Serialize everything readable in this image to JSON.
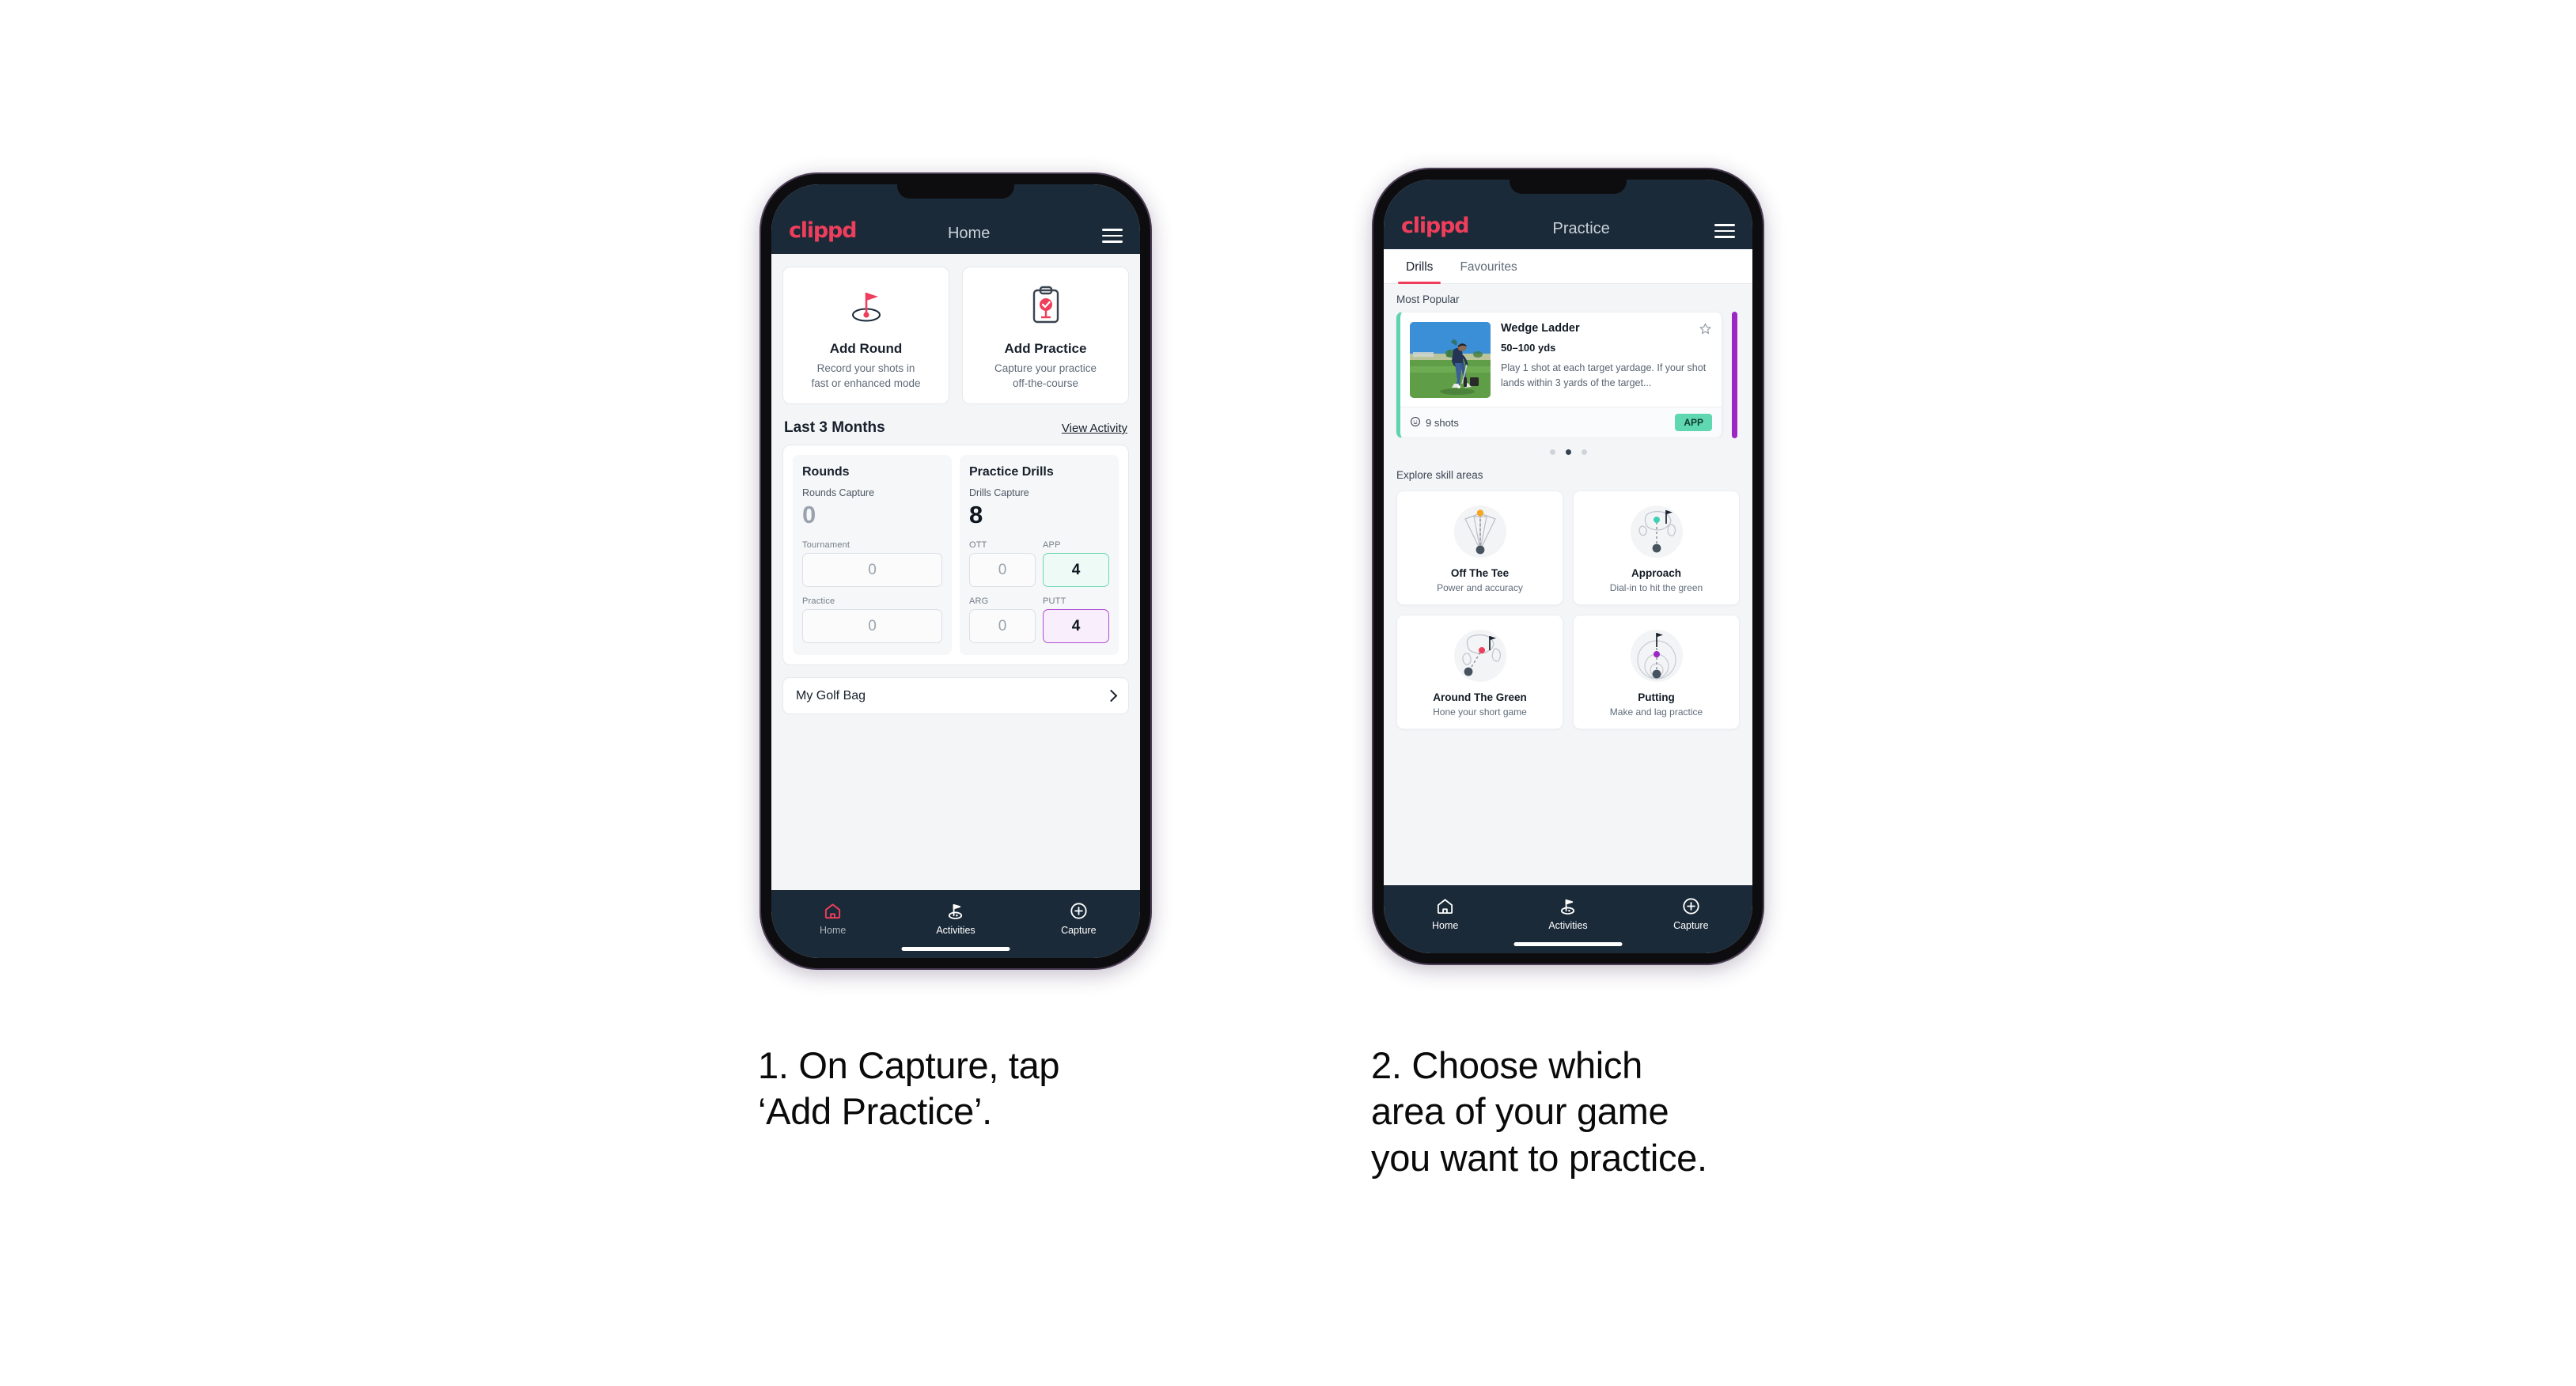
{
  "phone1": {
    "appbar": {
      "logo": "clippd",
      "title": "Home",
      "menu_icon": "hamburger-icon"
    },
    "actions": [
      {
        "icon": "golf-flag-icon",
        "title": "Add Round",
        "sub_line1": "Record your shots in",
        "sub_line2": "fast or enhanced mode"
      },
      {
        "icon": "clipboard-check-icon",
        "title": "Add Practice",
        "sub_line1": "Capture your practice",
        "sub_line2": "off-the-course"
      }
    ],
    "section": {
      "title": "Last 3 Months",
      "link": "View Activity"
    },
    "stats": {
      "rounds": {
        "name": "Rounds",
        "capture_label": "Rounds Capture",
        "capture_value": "0",
        "metrics": [
          {
            "label": "Tournament",
            "value": "0",
            "style": "plain"
          },
          {
            "label": "Practice",
            "value": "0",
            "style": "plain"
          }
        ]
      },
      "drills": {
        "name": "Practice Drills",
        "capture_label": "Drills Capture",
        "capture_value": "8",
        "metrics": [
          {
            "label": "OTT",
            "value": "0",
            "style": "plain"
          },
          {
            "label": "APP",
            "value": "4",
            "style": "green"
          },
          {
            "label": "ARG",
            "value": "0",
            "style": "plain"
          },
          {
            "label": "PUTT",
            "value": "4",
            "style": "purple"
          }
        ]
      }
    },
    "golf_bag": {
      "label": "My Golf Bag",
      "icon": "chevron-right-icon"
    },
    "nav": [
      {
        "icon": "home-icon",
        "label": "Home",
        "active": true
      },
      {
        "icon": "golf-activities-icon",
        "label": "Activities",
        "active": false
      },
      {
        "icon": "plus-circle-icon",
        "label": "Capture",
        "active": false
      }
    ]
  },
  "phone2": {
    "appbar": {
      "logo": "clippd",
      "title": "Practice",
      "menu_icon": "hamburger-icon"
    },
    "tabs": [
      {
        "label": "Drills",
        "active": true
      },
      {
        "label": "Favourites",
        "active": false
      }
    ],
    "most_popular_label": "Most Popular",
    "drill": {
      "title": "Wedge Ladder",
      "yardage": "50–100 yds",
      "description": "Play 1 shot at each target yardage. If your shot lands within 3 yards of the target...",
      "shots": "9 shots",
      "shots_icon": "clock-icon",
      "badge": "APP",
      "favourite_icon": "star-outline-icon",
      "accent_color": "#5ed3ad",
      "thumb_icon": "golfer-photo"
    },
    "carousel": {
      "dots": 3,
      "active_dot": 2,
      "next_card_accent": "#9b27c4"
    },
    "explore_label": "Explore skill areas",
    "skills": [
      {
        "name": "Off The Tee",
        "sub": "Power and accuracy",
        "icon": "tee-dispersion-icon",
        "dot_color": "#f5a623"
      },
      {
        "name": "Approach",
        "sub": "Dial-in to hit the green",
        "icon": "approach-green-icon",
        "dot_color": "#3fd0b5"
      },
      {
        "name": "Around The Green",
        "sub": "Hone your short game",
        "icon": "chip-green-icon",
        "dot_color": "#ef3e5c"
      },
      {
        "name": "Putting",
        "sub": "Make and lag practice",
        "icon": "putting-rings-icon",
        "dot_color": "#9b27c4"
      }
    ],
    "nav": [
      {
        "icon": "home-icon",
        "label": "Home",
        "active": false
      },
      {
        "icon": "golf-activities-icon",
        "label": "Activities",
        "active": false
      },
      {
        "icon": "plus-circle-icon",
        "label": "Capture",
        "active": false
      }
    ]
  },
  "captions": {
    "one_line1": "1. On Capture, tap",
    "one_line2": "‘Add Practice’.",
    "two_line1": "2. Choose which",
    "two_line2": "area of your game",
    "two_line3": "you want to practice."
  },
  "colors": {
    "brand_pink": "#ef3e5c",
    "navy": "#1b2a38",
    "green": "#5ed3ad",
    "purple": "#9b27c4"
  }
}
